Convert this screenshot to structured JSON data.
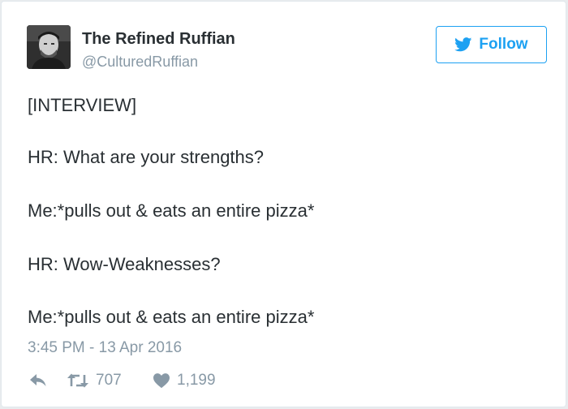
{
  "tweet": {
    "display_name": "The Refined Ruffian",
    "handle": "@CulturedRuffian",
    "follow_label": "Follow",
    "lines": [
      "[INTERVIEW]",
      "HR: What are your strengths?",
      "Me:*pulls out & eats an entire pizza*",
      "HR: Wow-Weaknesses?",
      "Me:*pulls out & eats an entire pizza*"
    ],
    "timestamp": "3:45 PM - 13 Apr 2016",
    "retweet_count": "707",
    "like_count": "1,199"
  },
  "colors": {
    "accent": "#1da1f2",
    "text": "#292f33",
    "muted": "#8899a6"
  },
  "icons": {
    "follow": "twitter-bird-icon",
    "reply": "reply-arrow-icon",
    "retweet": "retweet-icon",
    "like": "heart-icon"
  }
}
